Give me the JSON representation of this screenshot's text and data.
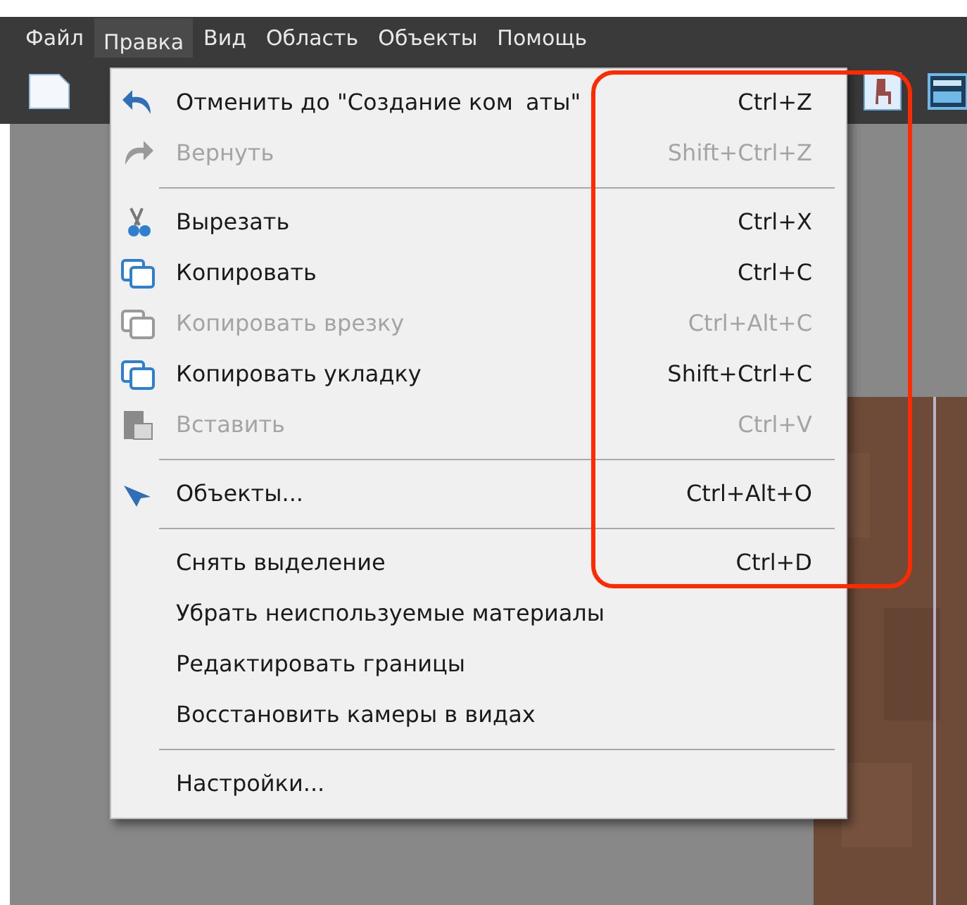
{
  "menubar": [
    {
      "label": "Файл",
      "selected": false
    },
    {
      "label": "Правка",
      "selected": true
    },
    {
      "label": "Вид",
      "selected": false
    },
    {
      "label": "Область",
      "selected": false
    },
    {
      "label": "Объекты",
      "selected": false
    },
    {
      "label": "Помощь",
      "selected": false
    }
  ],
  "menu": [
    {
      "kind": "item",
      "label": "Отменить до \"Создание ком",
      "label_2": "аты\"",
      "shortcut": "Ctrl+Z",
      "disabled": false
    },
    {
      "kind": "item",
      "label": "Вернуть",
      "shortcut": "Shift+Ctrl+Z",
      "disabled": true
    },
    {
      "kind": "separator"
    },
    {
      "kind": "item",
      "label": "Вырезать",
      "shortcut": "Ctrl+X",
      "disabled": false
    },
    {
      "kind": "item",
      "label": "Копировать",
      "shortcut": "Ctrl+C",
      "disabled": false
    },
    {
      "kind": "item",
      "label": "Копировать врезку",
      "shortcut": "Ctrl+Alt+C",
      "disabled": true
    },
    {
      "kind": "item",
      "label": "Копировать укладку",
      "shortcut": "Shift+Ctrl+C",
      "disabled": false
    },
    {
      "kind": "item",
      "label": "Вставить",
      "shortcut": "Ctrl+V",
      "disabled": true
    },
    {
      "kind": "separator"
    },
    {
      "kind": "item",
      "label": "Объекты...",
      "shortcut": "Ctrl+Alt+O",
      "disabled": false
    },
    {
      "kind": "separator"
    },
    {
      "kind": "item",
      "label": "Снять выделение",
      "shortcut": "Ctrl+D",
      "disabled": false
    },
    {
      "kind": "item",
      "label": "Убрать неиспользуемые материалы",
      "disabled": false
    },
    {
      "kind": "item",
      "label": "Редактировать границы",
      "disabled": false
    },
    {
      "kind": "item",
      "label": "Восстановить камеры в видах",
      "disabled": false
    },
    {
      "kind": "separator"
    },
    {
      "kind": "item",
      "label": "Настройки...",
      "disabled": false
    }
  ]
}
